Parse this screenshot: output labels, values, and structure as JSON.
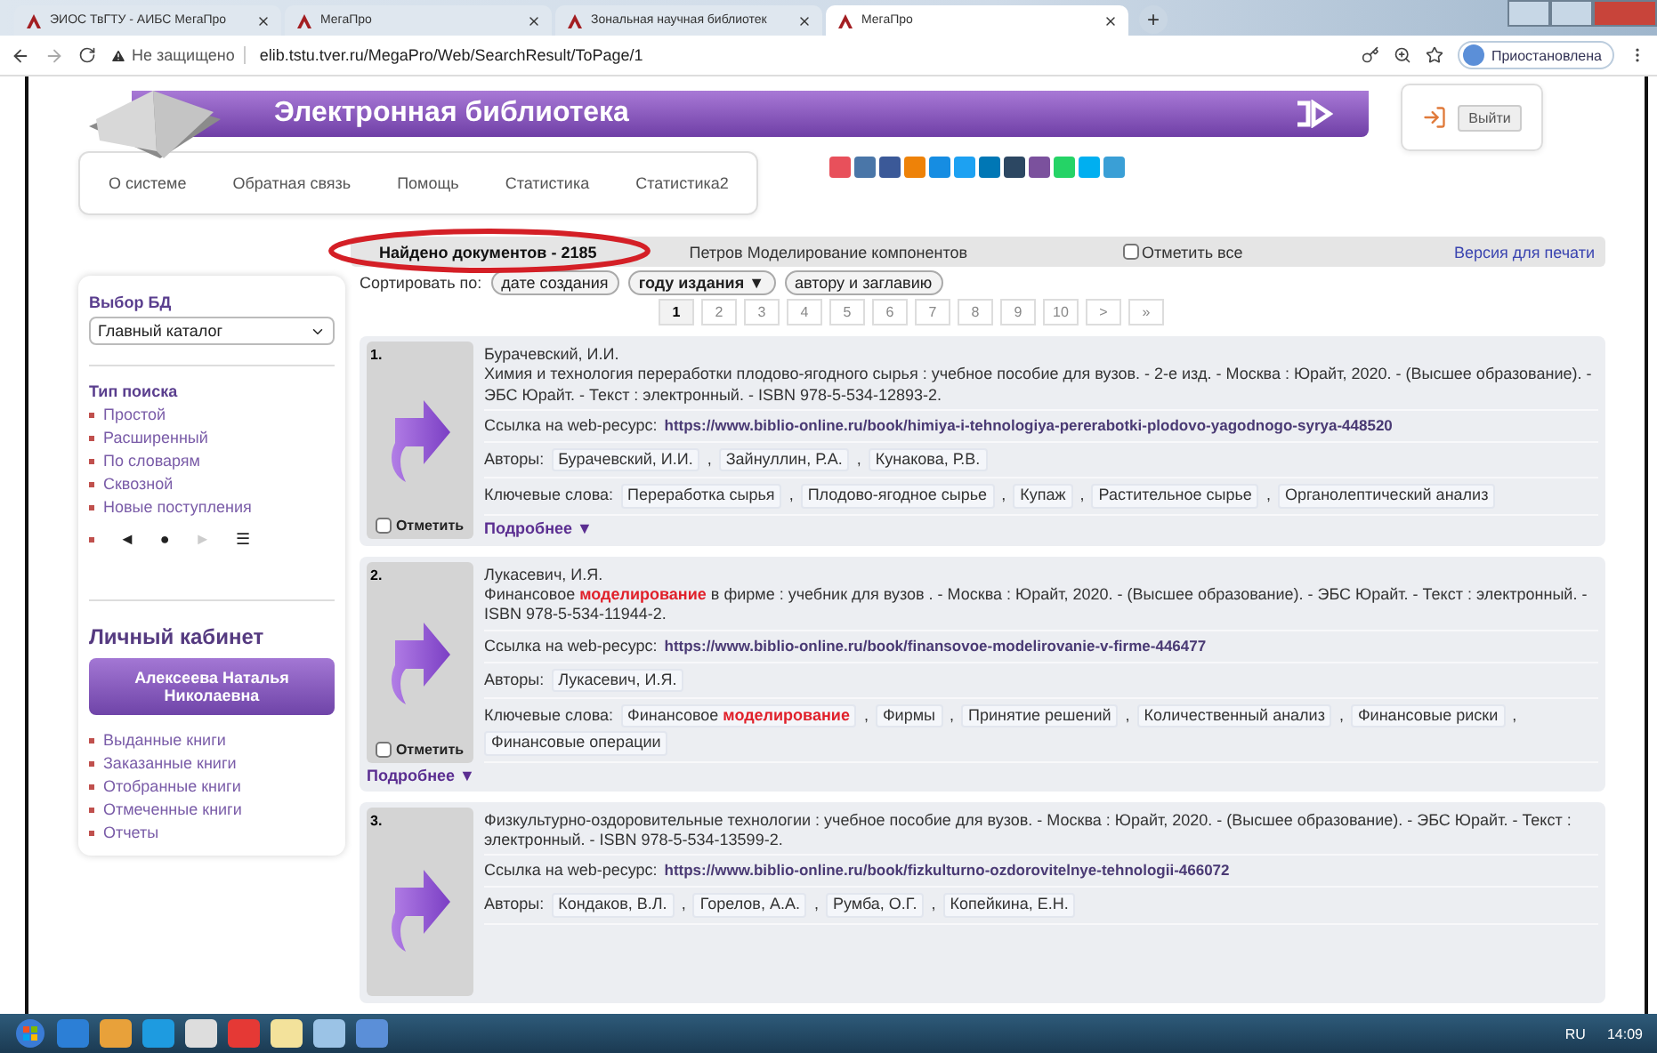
{
  "browser": {
    "tabs": [
      {
        "title": "ЭИОС ТвГТУ - АИБС МегаПро",
        "selected": false
      },
      {
        "title": "МегаПро",
        "selected": false
      },
      {
        "title": "Зональная научная библиотек",
        "selected": false
      },
      {
        "title": "МегаПро",
        "selected": true
      }
    ],
    "new_tab": "+",
    "security": "Не защищено",
    "url": "elib.tstu.tver.ru/MegaPro/Web/SearchResult/ToPage/1",
    "profile": "Приостановлена"
  },
  "header": {
    "title": "Электронная библиотека",
    "logout": "Выйти"
  },
  "nav": [
    "О системе",
    "Обратная связь",
    "Помощь",
    "Статистика",
    "Статистика2"
  ],
  "share": [
    {
      "color": "#e8505b"
    },
    {
      "color": "#4a76a8"
    },
    {
      "color": "#3b5998"
    },
    {
      "color": "#ee8208"
    },
    {
      "color": "#168de2"
    },
    {
      "color": "#1da1f2"
    },
    {
      "color": "#0077b5"
    },
    {
      "color": "#2c4762"
    },
    {
      "color": "#7b519d"
    },
    {
      "color": "#25d366"
    },
    {
      "color": "#00aff0"
    },
    {
      "color": "#3a9fd6"
    }
  ],
  "sidebar": {
    "db_label": "Выбор БД",
    "db_value": "Главный каталог",
    "search_type_label": "Тип поиска",
    "search_types": [
      "Простой",
      "Расширенный",
      "По словарям",
      "Сквозной",
      "Новые поступления"
    ],
    "controls": [
      {
        "glyph": "◄",
        "disabled": false
      },
      {
        "glyph": "●",
        "disabled": false
      },
      {
        "glyph": "►",
        "disabled": true
      },
      {
        "glyph": "☰",
        "disabled": false
      }
    ],
    "cabinet_title": "Личный кабинет",
    "user": "Алексеева Наталья Николаевна",
    "cabinet_links": [
      "Выданные книги",
      "Заказанные книги",
      "Отобранные книги",
      "Отмеченные книги",
      "Отчеты"
    ]
  },
  "results": {
    "found": "Найдено документов - 2185",
    "query": "Петров Моделирование компонентов",
    "select_all": {
      "label": "Отметить все",
      "checked": false
    },
    "print": "Версия для печати",
    "sort_label": "Сортировать по:",
    "sort_options": [
      {
        "label": "дате создания",
        "selected": false
      },
      {
        "label": "году издания ▼",
        "selected": true
      },
      {
        "label": "автору и заглавию",
        "selected": false
      }
    ],
    "pages": [
      {
        "label": "1",
        "selected": true
      },
      {
        "label": "2",
        "selected": false
      },
      {
        "label": "3",
        "selected": false
      },
      {
        "label": "4",
        "selected": false
      },
      {
        "label": "5",
        "selected": false
      },
      {
        "label": "6",
        "selected": false
      },
      {
        "label": "7",
        "selected": false
      },
      {
        "label": "8",
        "selected": false
      },
      {
        "label": "9",
        "selected": false
      },
      {
        "label": "10",
        "selected": false
      },
      {
        "label": ">",
        "selected": false
      },
      {
        "label": "»",
        "selected": false
      }
    ],
    "items": [
      {
        "number": "1.",
        "author": "Бурачевский, И.И.",
        "description": "Химия и технология переработки плодово-ягодного сырья : учебное пособие для вузов. - 2-е изд. - Москва : Юрайт, 2020. - (Высшее образование). - ЭБС Юрайт. - Текст : электронный. - ISBN 978-5-534-12893-2.",
        "link_label": "Ссылка на web-ресурс:",
        "url": "https://www.biblio-online.ru/book/himiya-i-tehnologiya-pererabotki-plodovo-yagodnogo-syrya-448520",
        "separator": ",",
        "authors_label": "Авторы:",
        "authors": [
          "Бурачевский, И.И.",
          "Зайнуллин, Р.А.",
          "Кунакова, Р.В."
        ],
        "keywords_label": "Ключевые слова:",
        "keywords": [
          "Переработка сырья",
          "Плодово-ягодное сырье",
          "Купаж",
          "Растительное сырье",
          "Органолептический анализ"
        ],
        "mark": "Отметить",
        "checked": false,
        "more": "Подробнее ▼"
      },
      {
        "number": "2.",
        "author": "Лукасевич, И.Я.",
        "description": "Финансовое **моделирование** в фирме : учебник для вузов . - Москва : Юрайт, 2020. - (Высшее образование). - ЭБС Юрайт. - Текст : электронный. - ISBN 978-5-534-11944-2.",
        "link_label": "Ссылка на web-ресурс:",
        "url": "https://www.biblio-online.ru/book/finansovoe-modelirovanie-v-firme-446477",
        "separator": ",",
        "authors_label": "Авторы:",
        "authors": [
          "Лукасевич, И.Я."
        ],
        "keywords_label": "Ключевые слова:",
        "keywords": [
          "Финансовое **моделирование**",
          "Фирмы",
          "Принятие решений",
          "Количественный анализ",
          "Финансовые риски",
          "Финансовые операции"
        ],
        "mark": "Отметить",
        "checked": false,
        "more": "Подробнее ▼"
      },
      {
        "number": "3.",
        "description": "Физкультурно-оздоровительные технологии : учебное пособие для вузов. - Москва : Юрайт, 2020. - (Высшее образование). - ЭБС Юрайт. - Текст : электронный. - ISBN 978-5-534-13599-2.",
        "link_label": "Ссылка на web-ресурс:",
        "url": "https://www.biblio-online.ru/book/fizkulturno-ozdorovitelnye-tehnologii-466072",
        "separator": ",",
        "authors_label": "Авторы:",
        "authors": [
          "Кондаков, В.Л.",
          "Горелов, А.А.",
          "Румба, О.Г.",
          "Копейкина, Е.Н."
        ]
      }
    ]
  },
  "taskbar": {
    "lang": "RU",
    "time": "14:09"
  }
}
